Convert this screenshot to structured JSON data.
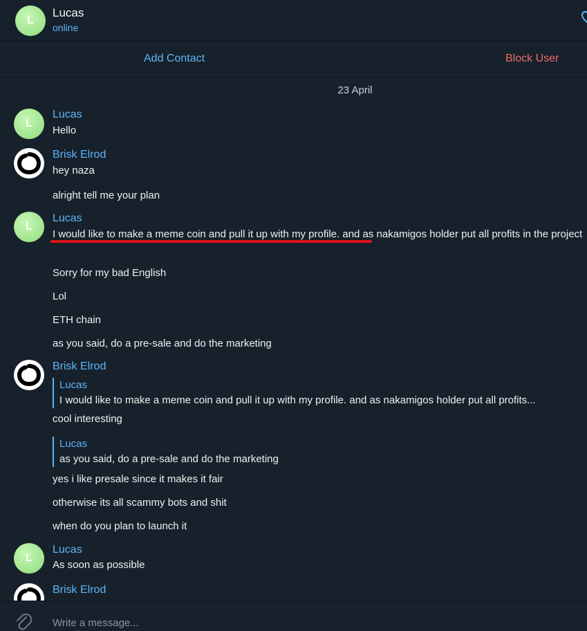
{
  "header": {
    "avatar_letter": "L",
    "name": "Lucas",
    "status": "online"
  },
  "actions": {
    "add_contact": "Add Contact",
    "block_user": "Block User"
  },
  "chat": {
    "date": "23 April",
    "messages": [
      {
        "sender": "Lucas",
        "avatar_letter": "L",
        "lines": [
          "Hello"
        ]
      },
      {
        "sender": "Brisk Elrod",
        "lines": [
          "hey naza",
          "alright tell me your plan"
        ]
      },
      {
        "sender": "Lucas",
        "avatar_letter": "L",
        "lines": [
          "I would like to make a meme coin and pull it up with my profile.  and as nakamigos holder put all profits in the project",
          "Sorry for my bad English",
          "Lol",
          "ETH chain",
          "as you said, do a pre-sale and do the marketing"
        ]
      },
      {
        "sender": "Brisk Elrod",
        "reply1": {
          "name": "Lucas",
          "text": "I would like to make a meme coin and pull it up with my profile.  and as nakamigos holder put all profits..."
        },
        "text1": "cool interesting",
        "reply2": {
          "name": "Lucas",
          "text": "as you said, do a pre-sale and do the marketing"
        },
        "lines": [
          "yes i like presale since it makes it fair",
          "otherwise its all scammy bots and shit",
          "when do you plan to launch it"
        ]
      },
      {
        "sender": "Lucas",
        "avatar_letter": "L",
        "lines": [
          "As soon as possible"
        ]
      },
      {
        "sender": "Brisk Elrod"
      }
    ]
  },
  "composer": {
    "placeholder": "Write a message..."
  },
  "colors": {
    "background": "#17212b",
    "accent": "#5eb5f7",
    "danger": "#ec6b6b",
    "highlight_underline": "#e0131b"
  },
  "icons": [
    "heart-icon",
    "paperclip-icon"
  ]
}
